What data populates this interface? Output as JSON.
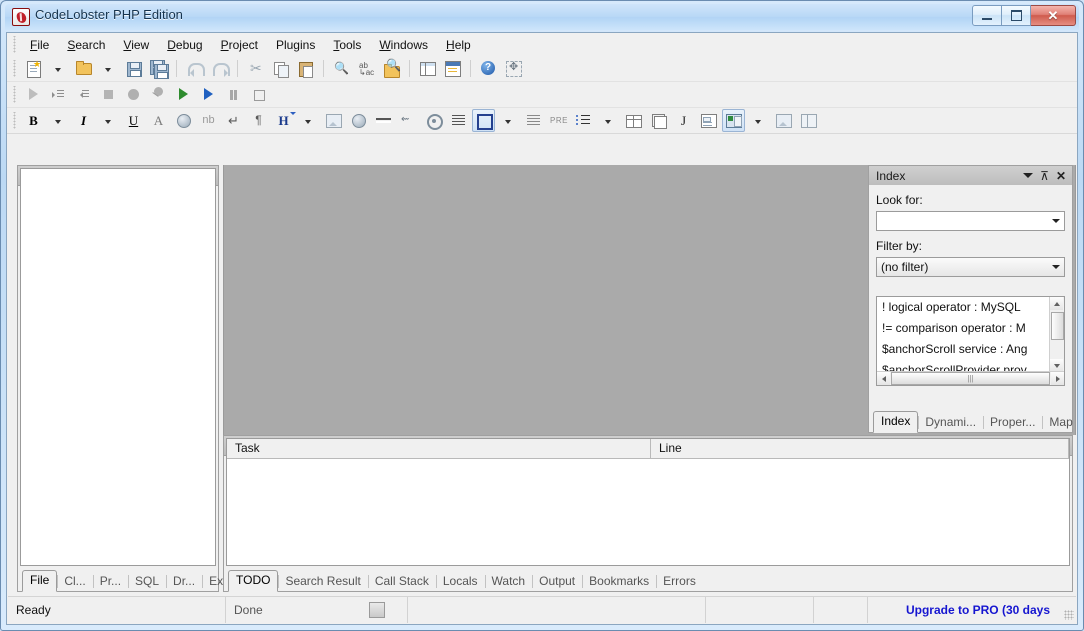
{
  "window": {
    "title": "CodeLobster PHP Edition",
    "app_icon": "lobster-icon",
    "minimize_label": "Minimize",
    "maximize_label": "Maximize",
    "close_label": "✕"
  },
  "menu": {
    "items": [
      {
        "label": "File",
        "accel": "F"
      },
      {
        "label": "Search",
        "accel": "S"
      },
      {
        "label": "View",
        "accel": "V"
      },
      {
        "label": "Debug",
        "accel": "D"
      },
      {
        "label": "Project",
        "accel": "P"
      },
      {
        "label": "Plugins",
        "accel": "g"
      },
      {
        "label": "Tools",
        "accel": "T"
      },
      {
        "label": "Windows",
        "accel": "W"
      },
      {
        "label": "Help",
        "accel": "H"
      }
    ]
  },
  "toolbar_main": {
    "items": [
      {
        "name": "new-file-button",
        "icon": "new-document-icon",
        "dropdown": true
      },
      {
        "name": "open-file-button",
        "icon": "open-folder-icon",
        "dropdown": true
      },
      {
        "name": "save-button",
        "icon": "save-icon"
      },
      {
        "name": "save-all-button",
        "icon": "save-all-icon"
      },
      {
        "name": "undo-button",
        "icon": "undo-icon"
      },
      {
        "name": "redo-button",
        "icon": "redo-icon"
      },
      {
        "name": "cut-button",
        "icon": "cut-icon"
      },
      {
        "name": "copy-button",
        "icon": "copy-icon"
      },
      {
        "name": "paste-button",
        "icon": "paste-icon"
      },
      {
        "name": "find-button",
        "icon": "find-binoculars-icon"
      },
      {
        "name": "replace-button",
        "icon": "replace-abac-icon"
      },
      {
        "name": "find-in-files-button",
        "icon": "find-in-folder-icon"
      },
      {
        "name": "preview-button",
        "icon": "split-pane-icon"
      },
      {
        "name": "properties-button",
        "icon": "properties-list-icon"
      },
      {
        "name": "help-button",
        "icon": "help-question-icon"
      },
      {
        "name": "fullscreen-button",
        "icon": "expand-arrows-icon"
      }
    ]
  },
  "toolbar_debug": {
    "items": [
      {
        "name": "run-button",
        "icon": "play-triangle-icon"
      },
      {
        "name": "step-into-button",
        "icon": "step-into-icon"
      },
      {
        "name": "step-out-button",
        "icon": "step-out-icon"
      },
      {
        "name": "stop-button",
        "icon": "stop-square-icon"
      },
      {
        "name": "breakpoint-button",
        "icon": "breakpoint-circle-icon"
      },
      {
        "name": "breakpoint-conditional-button",
        "icon": "conditional-breakpoint-icon"
      },
      {
        "name": "start-debug-button",
        "icon": "play-green-triangle-icon"
      },
      {
        "name": "run-to-cursor-button",
        "icon": "play-blue-triangle-icon"
      },
      {
        "name": "pause-button",
        "icon": "pause-icon"
      },
      {
        "name": "terminate-button",
        "icon": "stop-hollow-square-icon"
      }
    ]
  },
  "toolbar_format": {
    "items": [
      {
        "name": "bold-button",
        "icon": "bold-icon",
        "glyph": "B",
        "dropdown": true
      },
      {
        "name": "italic-button",
        "icon": "italic-icon",
        "glyph": "I",
        "dropdown": true
      },
      {
        "name": "underline-button",
        "icon": "underline-icon",
        "glyph": "U"
      },
      {
        "name": "font-color-button",
        "icon": "font-a-icon",
        "glyph": "A"
      },
      {
        "name": "special-char-button",
        "icon": "special-character-icon"
      },
      {
        "name": "nbsp-button",
        "icon": "nbsp-icon",
        "glyph": "nb"
      },
      {
        "name": "line-break-button",
        "icon": "line-break-icon",
        "glyph": "↵"
      },
      {
        "name": "paragraph-button",
        "icon": "paragraph-icon",
        "glyph": "¶"
      },
      {
        "name": "heading-button",
        "icon": "heading-h-icon",
        "glyph": "H",
        "dropdown": true
      },
      {
        "name": "insert-image-button",
        "icon": "image-icon"
      },
      {
        "name": "insert-link-button",
        "icon": "link-globe-icon"
      },
      {
        "name": "horizontal-rule-button",
        "icon": "horizontal-rule-icon"
      },
      {
        "name": "anchor-button",
        "icon": "anchor-icon"
      },
      {
        "name": "target-button",
        "icon": "target-icon"
      },
      {
        "name": "align-left-button",
        "icon": "align-left-icon"
      },
      {
        "name": "div-button",
        "icon": "div-box-icon",
        "dropdown": true
      },
      {
        "name": "align-right-button",
        "icon": "align-right-icon"
      },
      {
        "name": "preformatted-button",
        "icon": "pre-icon",
        "glyph": "PRE"
      },
      {
        "name": "list-button",
        "icon": "bullet-list-icon",
        "dropdown": true
      },
      {
        "name": "table-button",
        "icon": "table-icon"
      },
      {
        "name": "layers-button",
        "icon": "layers-icon"
      },
      {
        "name": "javascript-button",
        "icon": "javascript-j-icon",
        "glyph": "J"
      },
      {
        "name": "form-button",
        "icon": "form-icon"
      },
      {
        "name": "media-button",
        "icon": "media-object-icon",
        "dropdown": true
      },
      {
        "name": "thumbnail-button",
        "icon": "thumbnail-icon"
      },
      {
        "name": "frames-button",
        "icon": "frames-split-icon"
      }
    ]
  },
  "file_panel": {
    "title": "File",
    "caret_label": "▼",
    "pin_label": "⊼",
    "close_label": "✕",
    "tabs": [
      {
        "label": "File",
        "active": true
      },
      {
        "label": "Cl...",
        "active": false
      },
      {
        "label": "Pr...",
        "active": false
      },
      {
        "label": "SQL",
        "active": false
      },
      {
        "label": "Dr...",
        "active": false
      },
      {
        "label": "Ex...",
        "active": false
      }
    ]
  },
  "index_panel": {
    "title": "Index",
    "caret_label": "▼",
    "pin_label": "⊼",
    "close_label": "✕",
    "look_for_label": "Look for:",
    "look_for_value": "",
    "look_for_placeholder": "",
    "filter_by_label": "Filter by:",
    "filter_by_value": "(no filter)",
    "list_items": [
      "! logical operator : MySQL",
      "!= comparison operator : M",
      "$anchorScroll service : Ang",
      "$anchorScrollProvider prov"
    ],
    "tabs": [
      {
        "label": "Index",
        "active": true
      },
      {
        "label": "Dynami...",
        "active": false
      },
      {
        "label": "Proper...",
        "active": false
      },
      {
        "label": "Map",
        "active": false
      }
    ]
  },
  "todo_panel": {
    "title": "TODO",
    "caret_label": "▼",
    "pin_label": "⊼",
    "close_label": "✕",
    "columns": [
      "Task",
      "Line"
    ],
    "rows": [],
    "tabs": [
      {
        "label": "TODO",
        "active": true
      },
      {
        "label": "Search Result",
        "active": false
      },
      {
        "label": "Call Stack",
        "active": false
      },
      {
        "label": "Locals",
        "active": false
      },
      {
        "label": "Watch",
        "active": false
      },
      {
        "label": "Output",
        "active": false
      },
      {
        "label": "Bookmarks",
        "active": false
      },
      {
        "label": "Errors",
        "active": false
      }
    ]
  },
  "status_bar": {
    "ready_text": "Ready",
    "done_text": "Done",
    "upgrade_text": "Upgrade to PRO (30 days",
    "upgrade_color": "#1515d0"
  }
}
